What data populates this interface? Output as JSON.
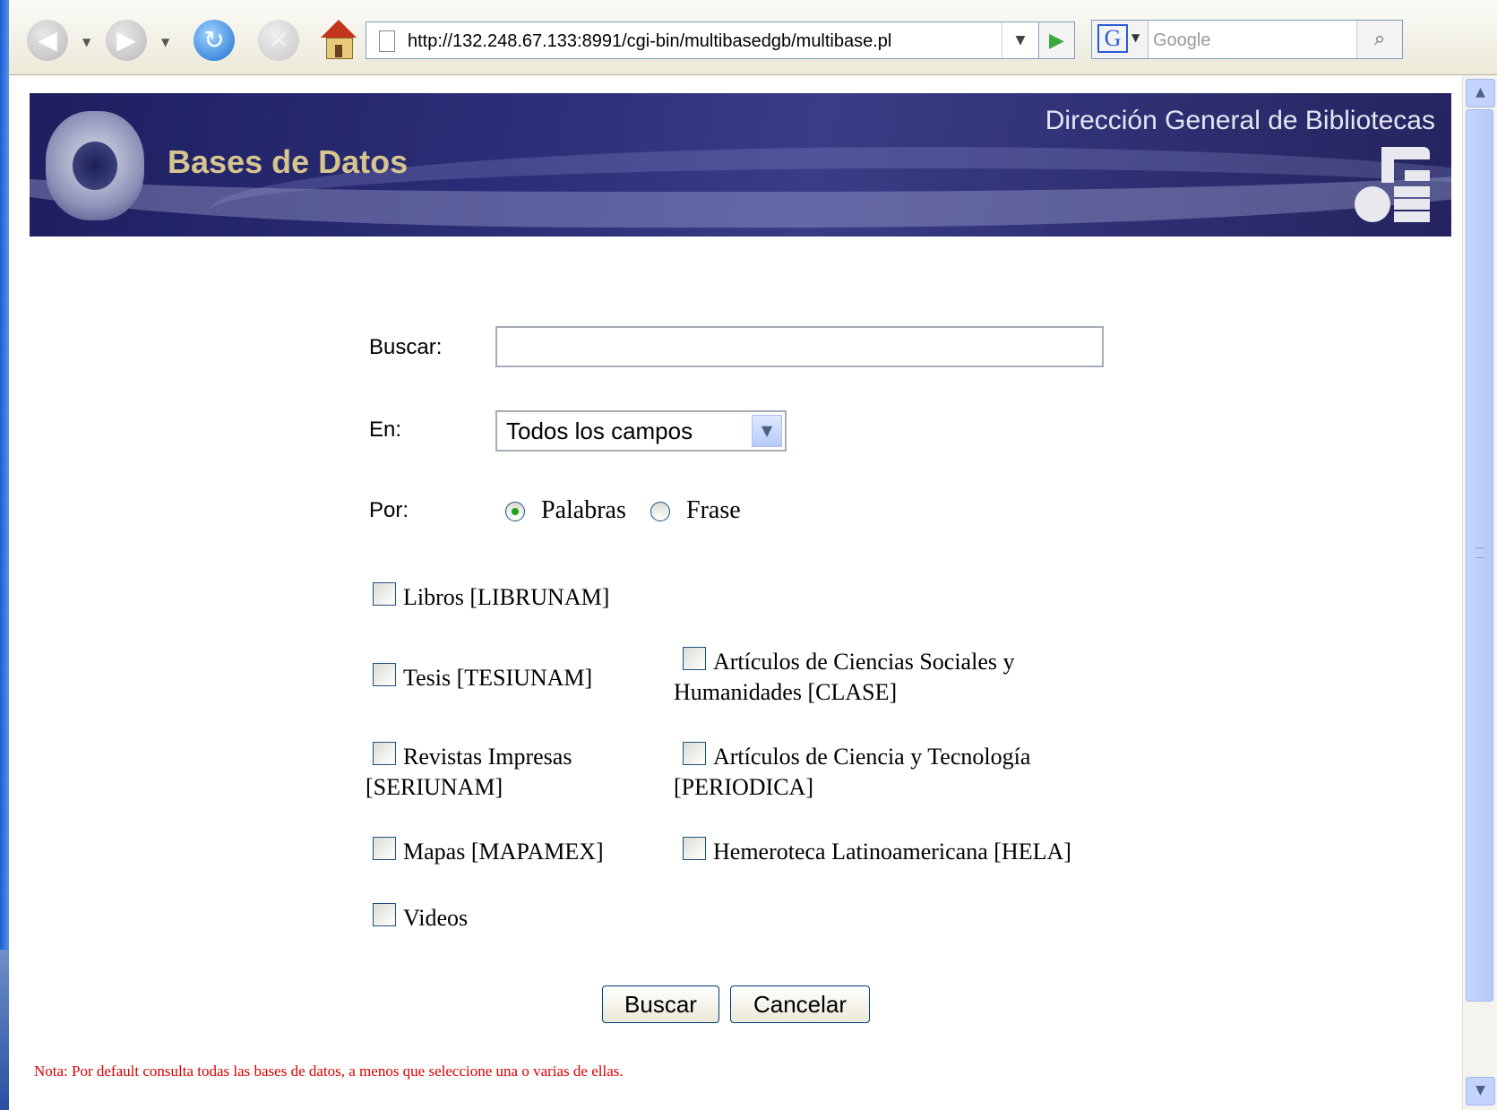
{
  "browser": {
    "url": "http://132.248.67.133:8991/cgi-bin/multibasedgb/multibase.pl",
    "search_placeholder": "Google",
    "icons": [
      "back-icon",
      "forward-icon",
      "reload-icon",
      "stop-icon",
      "home-icon",
      "page-icon",
      "go-icon",
      "google-icon",
      "search-icon"
    ]
  },
  "banner": {
    "title": "Bases de Datos",
    "org": "Dirección General de Bibliotecas"
  },
  "form": {
    "buscar_label": "Buscar:",
    "buscar_value": "",
    "en_label": "En:",
    "en_selected": "Todos los campos",
    "por_label": "Por:",
    "por_options": [
      {
        "label": "Palabras",
        "checked": true
      },
      {
        "label": "Frase",
        "checked": false
      }
    ],
    "databases": {
      "libros": "Libros [LIBRUNAM]",
      "tesis": "Tesis [TESIUNAM]",
      "clase_line1": "Artículos de Ciencias Sociales y",
      "clase_line2": "Humanidades [CLASE]",
      "revistas_line1": "Revistas Impresas",
      "revistas_line2": "[SERIUNAM]",
      "periodica_line1": "Artículos de Ciencia y Tecnología",
      "periodica_line2": "[PERIODICA]",
      "mapas": "Mapas [MAPAMEX]",
      "hela": "Hemeroteca Latinoamericana [HELA]",
      "videos": "Videos"
    },
    "submit_label": "Buscar",
    "cancel_label": "Cancelar",
    "note": "Nota: Por default consulta todas las bases de datos, a menos que seleccione una o varias de ellas."
  },
  "colors": {
    "banner_bg": "#23245f",
    "banner_title": "#d6c58e",
    "note": "#d90000"
  }
}
